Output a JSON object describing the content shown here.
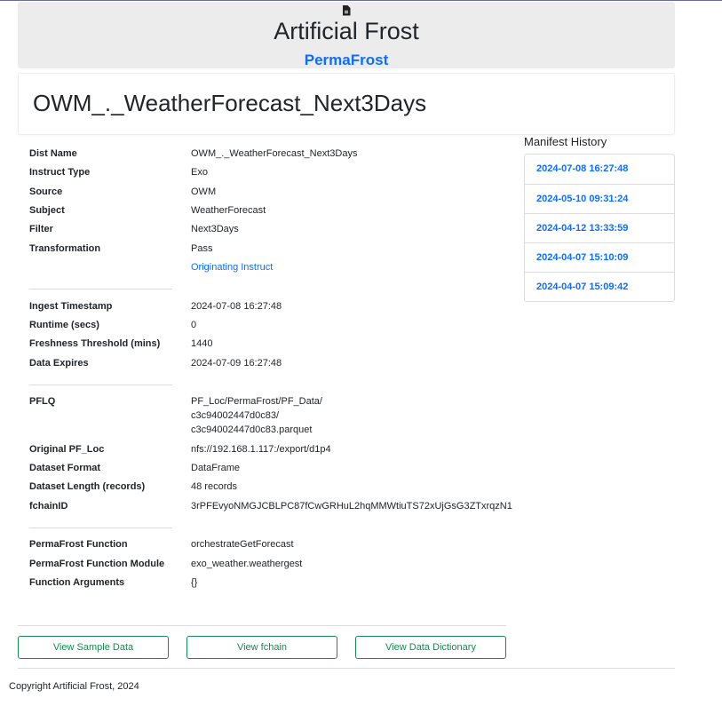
{
  "header": {
    "icon": "document-icon",
    "app_title": "Artificial Frost",
    "app_link": "PermaFrost"
  },
  "page_title": "OWM_._WeatherForecast_Next3Days",
  "details": {
    "group1": [
      {
        "label": "Dist Name",
        "value": "OWM_._WeatherForecast_Next3Days"
      },
      {
        "label": "Instruct Type",
        "value": "Exo"
      },
      {
        "label": "Source",
        "value": "OWM"
      },
      {
        "label": "Subject",
        "value": "WeatherForecast"
      },
      {
        "label": "Filter",
        "value": "Next3Days"
      },
      {
        "label": "Transformation",
        "value": "Pass"
      }
    ],
    "originating_instruct_link": "Originating Instruct",
    "group2": [
      {
        "label": "Ingest Timestamp",
        "value": "2024-07-08 16:27:48"
      },
      {
        "label": "Runtime (secs)",
        "value": "0"
      },
      {
        "label": "Freshness Threshold (mins)",
        "value": "1440"
      },
      {
        "label": "Data Expires",
        "value": "2024-07-09 16:27:48"
      }
    ],
    "pflq": {
      "label": "PFLQ",
      "lines": [
        "PF_Loc/PermaFrost/PF_Data/",
        "c3c94002447d0c83/",
        "c3c94002447d0c83.parquet"
      ]
    },
    "group3": [
      {
        "label": "Original PF_Loc",
        "value": "nfs://192.168.1.117:/export/d1p4"
      },
      {
        "label": "Dataset Format",
        "value": "DataFrame"
      },
      {
        "label": "Dataset Length (records)",
        "value": "48 records"
      },
      {
        "label": "fchainID",
        "value": "3rPFEvyoNMGJCBLPC87fCwGRHuL2hqMMWtiuTS72xUjGsG3ZTxrqzN1"
      }
    ],
    "group4": [
      {
        "label": "PermaFrost Function",
        "value": "orchestrateGetForecast"
      },
      {
        "label": "PermaFrost Function Module",
        "value": "exo_weather.weathergest"
      },
      {
        "label": "Function Arguments",
        "value": "{}"
      }
    ]
  },
  "buttons": {
    "sample": "View Sample Data",
    "fchain": "View fchain",
    "dictionary": "View Data Dictionary"
  },
  "history": {
    "title": "Manifest History",
    "items": [
      "2024-07-08 16:27:48",
      "2024-05-10 09:31:24",
      "2024-04-12 13:33:59",
      "2024-04-07 15:10:09",
      "2024-04-07 15:09:42"
    ]
  },
  "footer": "Copyright Artificial Frost, 2024",
  "colors": {
    "link": "#0d6efd",
    "button": "#198754",
    "header_bg": "#ececec"
  }
}
